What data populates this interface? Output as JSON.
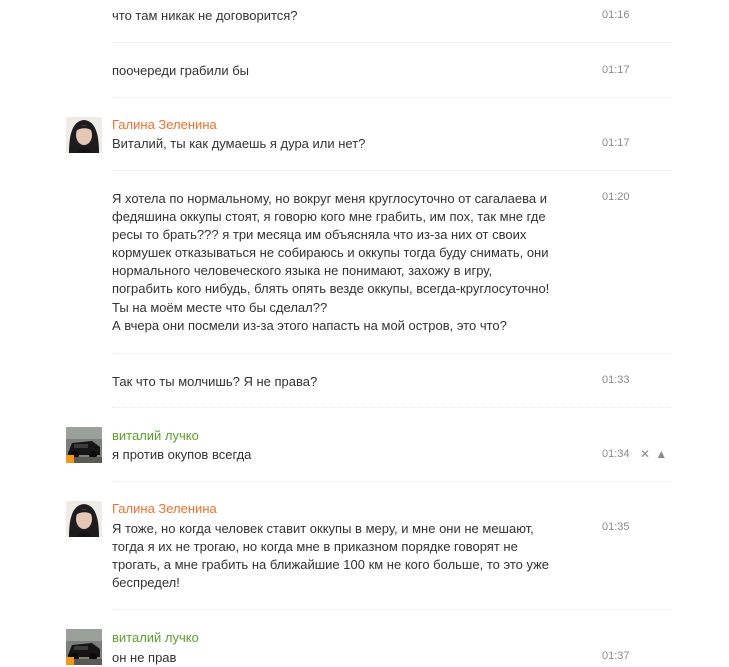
{
  "messages": [
    {
      "text": "что там никак не договорится?",
      "time": "01:16"
    },
    {
      "text": "поочереди грабили бы",
      "time": "01:17"
    },
    {
      "author": "Галина Зеленина",
      "text": "Виталий, ты как думаешь я дура или нет?",
      "time": "01:17"
    },
    {
      "lines": [
        "Я хотела по нормальному, но вокруг меня круглосуточно от сагалаева и",
        "федяшина оккупы стоят, я говорю кого мне грабить, им пох, так мне где",
        "ресы то брать???  я три месяца им объясняла что из-за них от своих",
        "кормушек отказываться не собираюсь и оккупы тогда буду снимать, они",
        "нормального человеческого языка не понимают, захожу в игру,",
        "пограбить кого нибудь, блять опять везде оккупы, всегда-круглосуточно!",
        "Ты на моём месте что бы сделал??",
        "А вчера они посмели из-за этого напасть на мой остров, это что?"
      ],
      "time": "01:20"
    },
    {
      "text": "Так что ты молчишь? Я не права?",
      "time": "01:33"
    },
    {
      "author": "виталий лучко",
      "text": "я против окупов всегда",
      "time": "01:34"
    },
    {
      "author": "Галина Зеленина",
      "lines": [
        "Я тоже, но когда человек ставит оккупы в меру, и мне они не мешают,",
        "тогда я их не трогаю, но когда мне в приказном порядке говорят не",
        "трогать, а мне грабить на ближайшие 100 км не кого больше, то это уже",
        "беспредел!"
      ],
      "time": "01:35"
    },
    {
      "author": "виталий лучко",
      "text": "он не прав",
      "time": "01:37"
    }
  ],
  "actions": {
    "delete_icon": "✕",
    "report_icon": "▲"
  },
  "colors": {
    "author_woman": "#eb722e",
    "author_man": "#5aa02c",
    "online_badge": "#f09a1c"
  }
}
